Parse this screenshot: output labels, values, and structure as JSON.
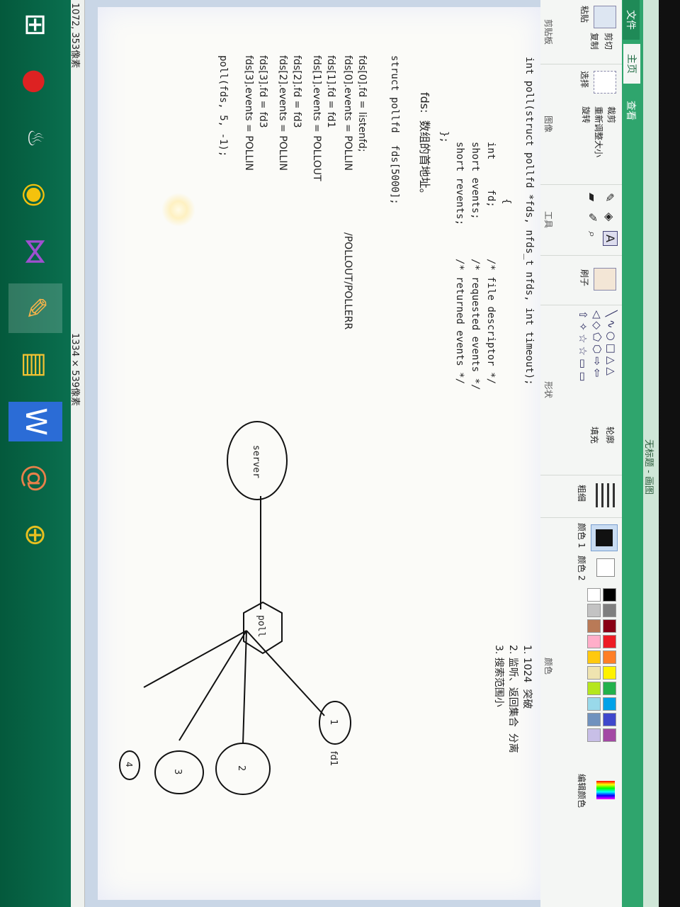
{
  "window": {
    "title": "无标题 - 画图"
  },
  "ribbon": {
    "tabs": [
      "文件",
      "主页",
      "查看"
    ],
    "clipboard": {
      "paste": "粘贴",
      "cut": "剪切",
      "copy": "复制",
      "label": "剪贴板"
    },
    "image": {
      "select": "选择",
      "crop": "裁剪",
      "resize": "重新调整大小",
      "rotate": "旋转",
      "label": "图像"
    },
    "tools": {
      "label": "工具",
      "brushes": "刷子",
      "text_tool": "A"
    },
    "shapes": {
      "label": "形状",
      "outline": "轮廓",
      "fill": "填充"
    },
    "size": {
      "label": "粗细"
    },
    "colors": {
      "color1": "颜色 1",
      "color2": "颜色 2",
      "edit": "编辑颜色",
      "label": "颜色",
      "palette": [
        "#000000",
        "#7f7f7f",
        "#880015",
        "#ed1c24",
        "#ff7f27",
        "#fff200",
        "#22b14c",
        "#00a2e8",
        "#3f48cc",
        "#a349a4",
        "#ffffff",
        "#c3c3c3",
        "#b97a57",
        "#ffaec9",
        "#ffc90e",
        "#efe4b0",
        "#b5e61d",
        "#99d9ea",
        "#7092be",
        "#c8bfe7"
      ]
    }
  },
  "canvas": {
    "code_lines": [
      "int poll(struct pollfd *fds, nfds_t nfds, int timeout);",
      "{",
      "int     fd;",
      "short events;",
      "short revents;",
      "};",
      "/* file descriptor */",
      "/* requested events */",
      "/* returned events */",
      "struct pollfd  fds[5000];",
      "fds[0].fd = listenfd;",
      "fds[0].events = POLLIN",
      "/POLLOUT/POLLERR",
      "fds[1].fd = fd1",
      "fds[1].events = POLLOUT",
      "fds[2].fd = fd3",
      "fds[2].events = POLLIN",
      "fds[3].fd = fd3",
      "fds[3].events = POLLIN",
      "poll(fds, 5, -1);"
    ],
    "fds_note": "fds:  数组的首地址。",
    "list": [
      "1. 1024  突破",
      "2. 监听、返回集合  分离",
      "3. 搜索范围小"
    ],
    "diagram": {
      "server": "server",
      "poll": "poll",
      "nodes": [
        "1",
        "2",
        "3",
        "4"
      ],
      "fd1_label": "fd1"
    }
  },
  "status": {
    "cursor": "1072, 353像素",
    "size": "1334 × 539像素"
  },
  "taskbar": {
    "icons": [
      "start-icon",
      "record-icon",
      "qq-icon",
      "chrome-icon",
      "visual-studio-icon",
      "paint-icon",
      "explorer-icon",
      "word-icon",
      "snail-icon",
      "ue-icon"
    ]
  }
}
